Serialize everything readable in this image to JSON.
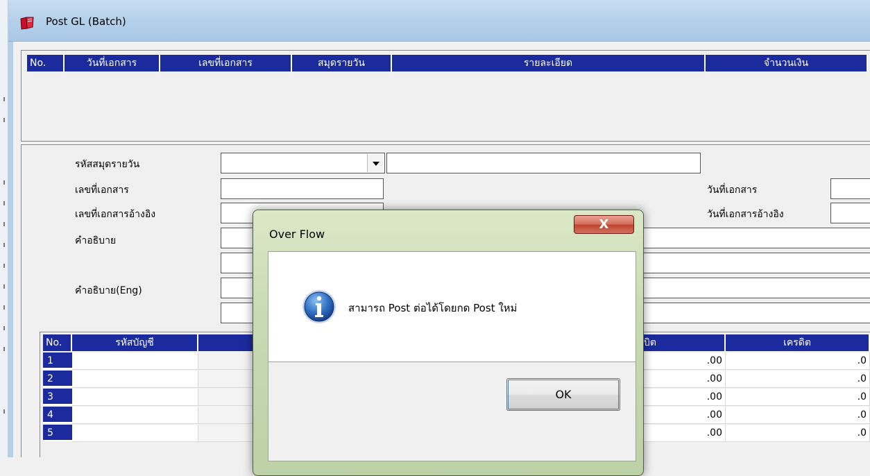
{
  "window": {
    "title": "Post GL (Batch)"
  },
  "batch_grid": {
    "headers": [
      "No.",
      "วันที่เอกสาร",
      "เลขที่เอกสาร",
      "สมุดรายวัน",
      "รายละเอียด",
      "จำนวนเงิน"
    ]
  },
  "form": {
    "journal_code_label": "รหัสสมุดรายวัน",
    "doc_no_label": "เลขที่เอกสาร",
    "ref_doc_no_label": "เลขที่เอกสารอ้างอิง",
    "description_label": "คำอธิบาย",
    "description_eng_label": "คำอธิบาย(Eng)",
    "doc_date_label": "วันที่เอกสาร",
    "ref_doc_date_label": "วันที่เอกสารอ้างอิง"
  },
  "detail_grid": {
    "headers": {
      "no": "No.",
      "account_code": "รหัสบัญชี",
      "debit_partial": "บิต",
      "credit": "เครดิต"
    },
    "rows": [
      {
        "no": "1",
        "debit": ".00",
        "credit": ".0"
      },
      {
        "no": "2",
        "debit": ".00",
        "credit": ".0"
      },
      {
        "no": "3",
        "debit": ".00",
        "credit": ".0"
      },
      {
        "no": "4",
        "debit": ".00",
        "credit": ".0"
      },
      {
        "no": "5",
        "debit": ".00",
        "credit": ".0"
      }
    ]
  },
  "dialog": {
    "title": "Over Flow",
    "message": "สามารถ Post ต่อได้โดยกด Post ใหม่",
    "ok_label": "OK",
    "close_glyph": "X",
    "icon": "info-icon"
  },
  "colors": {
    "grid_header": "#1b2b9e",
    "dialog_frame": "#c7dab2",
    "close_button": "#c0452f"
  }
}
